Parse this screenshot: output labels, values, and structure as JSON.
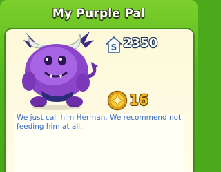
{
  "dialog": {
    "title": "My Purple Pal"
  },
  "pet": {
    "name_icon": "purple-pet-herman-illustration"
  },
  "price": {
    "icon": "house-cost-icon",
    "icon_letter": "S",
    "value": "2350"
  },
  "reward": {
    "icon": "gold-coin-icon",
    "value": "16"
  },
  "description": {
    "text": "We just call him Herman. We recommend not feeding him at all."
  },
  "colors": {
    "frame_green": "#56b31e",
    "card_cream": "#fcf8d8",
    "description_blue": "#3a6cc0",
    "coin_gold": "#f4b91c",
    "pet_purple": "#8a45c9"
  }
}
